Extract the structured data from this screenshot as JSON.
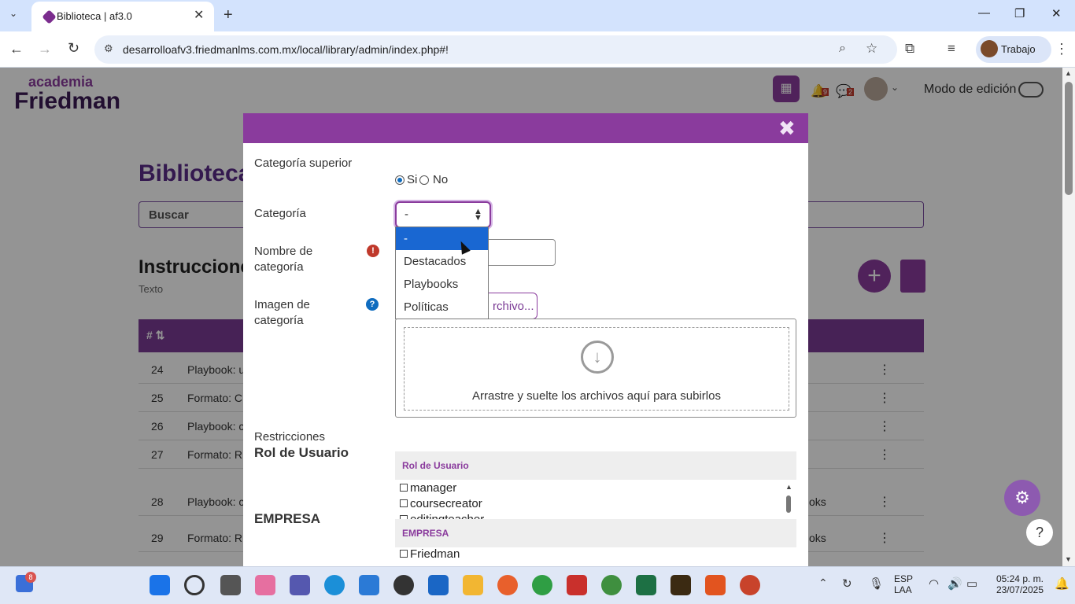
{
  "browser": {
    "tab_title": "Biblioteca | af3.0",
    "url": "desarrolloafv3.friedmanlms.com.mx/local/library/admin/index.php#!",
    "profile_name": "Trabajo"
  },
  "header": {
    "logo_top": "academia",
    "logo_main": "Friedman",
    "notif_count": "9",
    "msg_count": "2",
    "edit_mode_label": "Modo de edición"
  },
  "page": {
    "title": "Biblioteca",
    "search_placeholder": "Buscar",
    "section_title": "Instrucciones",
    "section_sub": "Texto",
    "table_head_num": "# ⇅",
    "rows": [
      {
        "num": "24",
        "text": "Playbook: u"
      },
      {
        "num": "25",
        "text": "Formato: C"
      },
      {
        "num": "26",
        "text": "Playbook: c"
      },
      {
        "num": "27",
        "text": "Formato: R"
      },
      {
        "num": "28",
        "text": "Playbook: c"
      },
      {
        "num": "29",
        "text": "Formato: R"
      }
    ],
    "row_tail_28": "oks",
    "row_tail_29": "oks"
  },
  "modal": {
    "label_parent": "Categoría superior",
    "radio_yes": "Si",
    "radio_no": "No",
    "label_category": "Categoría",
    "select_value": "-",
    "label_name": "Nombre de categoría",
    "label_image": "Imagen de categoría",
    "file_button": "rchivo...",
    "drop_text": "Arrastre y suelte los archivos aquí para subirlos",
    "restrictions": "Restricciones",
    "role_title": "Rol de Usuario",
    "empresa_title": "EMPRESA",
    "role_header": "Rol de Usuario",
    "roles": [
      "manager",
      "coursecreator",
      "editingteacher"
    ],
    "empresa_header": "EMPRESA",
    "empresas": [
      "Friedman"
    ],
    "options": [
      "-",
      "Destacados",
      "Playbooks",
      "Políticas"
    ],
    "selected_option": "-"
  },
  "taskbar": {
    "start_badge": "8",
    "lang": "ESP",
    "lang2": "LAA",
    "time": "05:24 p. m.",
    "date": "23/07/2025"
  }
}
